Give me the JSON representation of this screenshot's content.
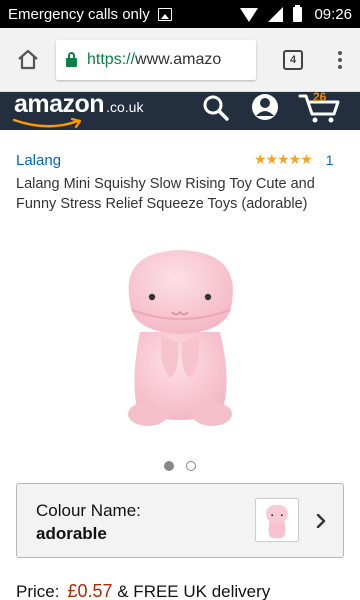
{
  "status_bar": {
    "carrier_text": "Emergency calls only",
    "time": "09:26"
  },
  "browser": {
    "url_scheme": "https://",
    "url_host": "www.amazo",
    "tab_count": "4"
  },
  "amazon_header": {
    "logo_word": "amazon",
    "logo_tld": ".co.uk",
    "cart_count": "26"
  },
  "product": {
    "brand": "Lalang",
    "stars": "★★★★★",
    "rating_count": "1",
    "title": "Lalang Mini Squishy Slow Rising Toy Cute and Funny Stress Relief Squeeze Toys (adorable)"
  },
  "carousel": {
    "active_index": 0,
    "total": 2
  },
  "colour_selector": {
    "label": "Colour Name:",
    "value": "adorable"
  },
  "price": {
    "label": "Price:",
    "value": "£0.57",
    "delivery": "& FREE UK delivery"
  },
  "colors": {
    "amazon_header": "#232f3e",
    "link_blue": "#0066c0",
    "price_red": "#b12704",
    "star_orange": "#f8a31b",
    "secure_green": "#0b8043",
    "cart_orange": "#f08804",
    "toy_pink": "#f9c8d3"
  }
}
